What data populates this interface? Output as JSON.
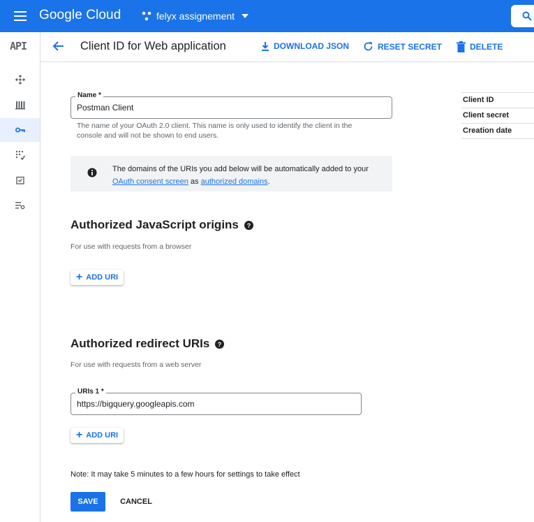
{
  "app": {
    "logo_text": "Google Cloud",
    "project_name": "felyx assignement",
    "brand_color": "#1a73e8"
  },
  "rail": {
    "api_label": "API",
    "items": [
      {
        "icon": "dashboard-diamond-icon"
      },
      {
        "icon": "library-icon"
      },
      {
        "icon": "key-icon",
        "active": true
      },
      {
        "icon": "oauth-consent-icon"
      },
      {
        "icon": "page-usage-agreements-icon"
      },
      {
        "icon": "settings-list-icon"
      }
    ]
  },
  "header": {
    "title": "Client ID for Web application",
    "download_json": "DOWNLOAD JSON",
    "reset_secret": "RESET SECRET",
    "delete": "DELETE"
  },
  "form": {
    "name_label": "Name *",
    "name_value": "Postman Client",
    "name_helper": "The name of your OAuth 2.0 client. This name is only used to identify the client in the console and will not be shown to end users.",
    "info": {
      "text_before": "The domains of the URIs you add below will be automatically added to your",
      "link1": "OAuth consent screen",
      "text_mid": "as",
      "link2": "authorized domains",
      "text_after": "."
    },
    "js_origins": {
      "title": "Authorized JavaScript origins",
      "subtitle": "For use with requests from a browser",
      "add_label": "ADD URI"
    },
    "redirect_uris": {
      "title": "Authorized redirect URIs",
      "subtitle": "For use with requests from a web server",
      "uri_label": "URIs 1 *",
      "uri_value": "https://bigquery.googleapis.com",
      "add_label": "ADD URI"
    },
    "note": "Note: It may take 5 minutes to a few hours for settings to take effect",
    "save_label": "SAVE",
    "cancel_label": "CANCEL"
  },
  "side": {
    "rows": [
      "Client ID",
      "Client secret",
      "Creation date"
    ]
  }
}
